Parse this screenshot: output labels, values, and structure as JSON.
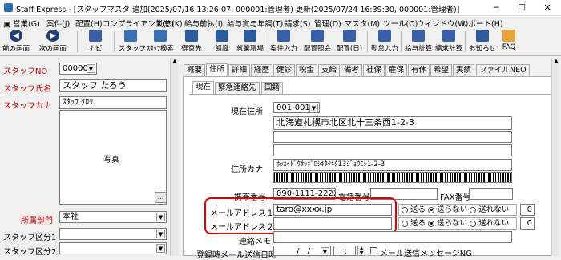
{
  "window": {
    "title": "Staff Express - [スタッフマスタ 追加(2025/07/16 13:26:07, 000001:管理者) 更新(2025/07/24 16:39:30, 000001:管理者)]",
    "minimize": "─",
    "maximize": "☐",
    "close": "✕"
  },
  "menu": [
    "営業(G)",
    "案件(J)",
    "配置(H)",
    "コンプライアンス(C)",
    "勤怠(K)",
    "給与前払(I)",
    "給与賞与年調(T)",
    "請求(S)",
    "管理(D)",
    "マスタ(M)",
    "ツール(O)",
    "ウィンドウ(W)",
    "サポート(H)"
  ],
  "toolbar": [
    {
      "label": "前の画面",
      "icon": "back-icon"
    },
    {
      "label": "次の画面",
      "icon": "forward-icon"
    },
    {
      "label": "ナビ",
      "icon": "navi-icon"
    },
    {
      "label": "スタッフ",
      "icon": "staff-icon"
    },
    {
      "label": "ｽﾀｯﾌ検索",
      "icon": "staff-search-icon"
    },
    {
      "label": "得意先",
      "icon": "customer-icon"
    },
    {
      "label": "組織",
      "icon": "organization-icon"
    },
    {
      "label": "就業現場",
      "icon": "worksite-icon"
    },
    {
      "label": "案件入力",
      "icon": "job-input-icon"
    },
    {
      "label": "配置照会",
      "icon": "assignment-query-icon"
    },
    {
      "label": "配置(日)",
      "icon": "assignment-day-icon"
    },
    {
      "label": "勤怠入力",
      "icon": "attendance-icon"
    },
    {
      "label": "給与計算",
      "icon": "payroll-icon"
    },
    {
      "label": "請求計算",
      "icon": "billing-icon"
    },
    {
      "label": "お知らせ",
      "icon": "notice-icon"
    },
    {
      "label": "FAQ",
      "icon": "faq-icon"
    }
  ],
  "left": {
    "staff_no_label": "スタッフNO",
    "staff_no": "000002",
    "name_label": "スタッフ氏名",
    "name": "スタッフ たろう",
    "kana_label": "スタッフカナ",
    "kana": "ｽﾀｯﾌ ﾀﾛｳ",
    "photo_label": "写真",
    "photo_btn": "...",
    "dept_label": "所属部門",
    "dept": "本社",
    "kubun1_label": "スタッフ区分1",
    "kubun2_label": "スタッフ区分2"
  },
  "tabs": [
    "概要",
    "住所",
    "詳細",
    "経歴",
    "健診",
    "税金",
    "支給",
    "備考",
    "社保",
    "雇保",
    "有休",
    "希望",
    "実績",
    "ファイル",
    "NEO"
  ],
  "subtabs": [
    "現在",
    "緊急連絡先",
    "国籍"
  ],
  "form": {
    "address_label": "現在住所",
    "postal": "001-0013",
    "address1": "北海道札幌市北区北十三条西1-2-3",
    "kana_label": "住所カナ",
    "kana_address": "ﾎｯｶｲﾄﾞｳｻｯﾎﾟﾛｼｷﾀｸｷﾀ13ｼﾞｮｳﾆｼ1-2-3",
    "mobile_label": "携帯番号",
    "mobile": "090-1111-2222",
    "phone_label": "電話番号",
    "fax_label": "FAX番号",
    "mail1_label": "メールアドレス１",
    "mail1": "taro@xxxx.jp",
    "mail2_label": "メールアドレス２",
    "mail2": "",
    "radio_send": "送る",
    "radio_nosend": "送らない",
    "radio_cannot": "送れない",
    "count1": "0",
    "count2": "0",
    "memo_label": "連絡メモ",
    "regmail_label": "登録時メール送信日時",
    "date_placeholder": "/　/",
    "time_placeholder": ":",
    "nomsg_label": "メール送信メッセージNG"
  },
  "colors": {
    "highlight": "#e00000",
    "label_red": "#e00000"
  }
}
